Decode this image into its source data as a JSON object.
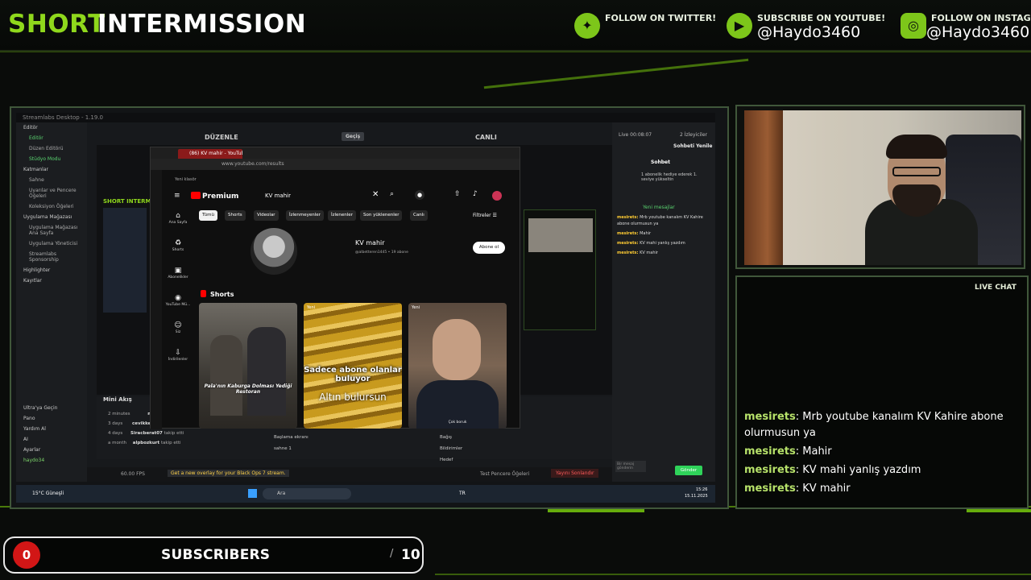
{
  "header": {
    "title_part1": "SHORT",
    "title_part2": "INTERMISSION",
    "socials": [
      {
        "label": "FOLLOW ON TWITTER!",
        "handle": "",
        "icon": "twitter-icon"
      },
      {
        "label": "SUBSCRIBE ON YOUTUBE!",
        "handle": "@Haydo3460",
        "icon": "youtube-icon"
      },
      {
        "label": "FOLLOW ON INSTAGRAM!",
        "handle": "@Haydo3460",
        "icon": "instagram-icon"
      }
    ]
  },
  "streamlabs": {
    "window_title": "Streamlabs Desktop - 1.19.0",
    "sidebar": [
      "Editör",
      "Editör",
      "Düzen Editörü",
      "Stüdyo Modu",
      "Katmanlar",
      "Sahne",
      "Uyarılar ve Pencere Öğeleri",
      "Koleksiyon Öğeleri",
      "Uygulama Mağazası",
      "Uygulama Mağazası Ana Sayfa",
      "Uygulama Yöneticisi",
      "Streamlabs Sponsorship",
      "Highlighter",
      "Kayıtlar"
    ],
    "sidebar_bottom": [
      "Ultra'ya Geçin",
      "Pano",
      "Yardım Al",
      "AI",
      "Ayarlar",
      "haydo34"
    ],
    "top_left": "DÜZENLE",
    "top_mid": "Geçiş",
    "top_right": "CANLI",
    "scene_label": "SHORT INTERM",
    "mini_feed_title": "Mini Akış",
    "feed": [
      {
        "time": "2 minutes",
        "user": "mesi"
      },
      {
        "time": "3 days",
        "user": "cevikke"
      },
      {
        "time": "4 days",
        "user": "Siracberat07",
        "action": "takip etti"
      },
      {
        "time": "a month",
        "user": "alpbozkurt",
        "action": "takip etti"
      }
    ],
    "scenes": [
      "Başlama ekranı",
      "sahne 1"
    ],
    "sources": [
      "Bağış",
      "Bildirimler",
      "Hedef"
    ],
    "status_fps": "60.00 FPS",
    "status_promo": "Get a new overlay for your Black Ops 7 stream.",
    "status_test": "Test Pencere Öğeleri",
    "status_end": "Yayını Sonlandır",
    "chat_panel": {
      "live": "Live 00:08:07",
      "viewers": "2 İzleyiciler",
      "refresh": "Sohbeti Yenile",
      "title": "Sohbet",
      "notice": "1 abonelik hediye ederek 1. seviye yükseltin",
      "new_msgs": "Yeni mesajlar",
      "messages": [
        {
          "user": "mesirets:",
          "text": "Mrb youtube kanalım KV Kahire abone olurmusun ya"
        },
        {
          "user": "mesirets:",
          "text": "Mahir"
        },
        {
          "user": "mesirets:",
          "text": "KV mahi yanlış yazdım"
        },
        {
          "user": "mesirets:",
          "text": "KV mahir"
        }
      ],
      "input_placeholder": "Bir mesaj gönderin",
      "send": "Gönder"
    }
  },
  "browser": {
    "tab_title": "(86) KV mahir - YouTube",
    "url": "www.youtube.com/results",
    "new_window": "Yeni klasör",
    "logo": "Premium",
    "search_value": "KV mahir",
    "chips": [
      "Tümü",
      "Shorts",
      "Videolar",
      "İzlenmeyenler",
      "İzlenenler",
      "Son yüklenenler",
      "Canlı"
    ],
    "filter": "Filtreler",
    "nav": [
      "Ana Sayfa",
      "Shorts",
      "Abonelikler",
      "YouTube Mü...",
      "Siz",
      "İndirilenler"
    ],
    "channel_name": "KV mahir",
    "channel_sub": "@albetteren1445 • 19 abone",
    "subscribe": "Abone ol",
    "shorts_heading": "Shorts",
    "shorts": [
      {
        "badge": "",
        "caption": "Pala'nın Kaburga Dolması Yediği Restoran"
      },
      {
        "badge": "Yeni",
        "caption": "Sadece abone olanlar buluyor",
        "caption2": "Altın bulursun"
      },
      {
        "badge": "Yeni",
        "caption": "Çok boruk"
      }
    ]
  },
  "taskbar": {
    "weather": "15°C Güneşli",
    "search": "Ara",
    "lang": "TR",
    "time": "15:26",
    "date": "15.11.2025"
  },
  "live_chat": {
    "title": "LIVE CHAT",
    "messages": [
      {
        "user": "mesirets",
        "text": ": Mrb youtube kanalım KV Kahire abone olurmusun ya"
      },
      {
        "user": "mesirets",
        "text": ": Mahir"
      },
      {
        "user": "mesirets",
        "text": ": KV mahi yanlış yazdım"
      },
      {
        "user": "mesirets",
        "text": ": KV mahir"
      }
    ]
  },
  "subscriber_bar": {
    "count": "0",
    "label": "SUBSCRIBERS",
    "goal": "10"
  },
  "colors": {
    "accent": "#8fd81c",
    "frame": "#40573a",
    "youtube_red": "#ff0000",
    "count_red": "#d21616"
  }
}
